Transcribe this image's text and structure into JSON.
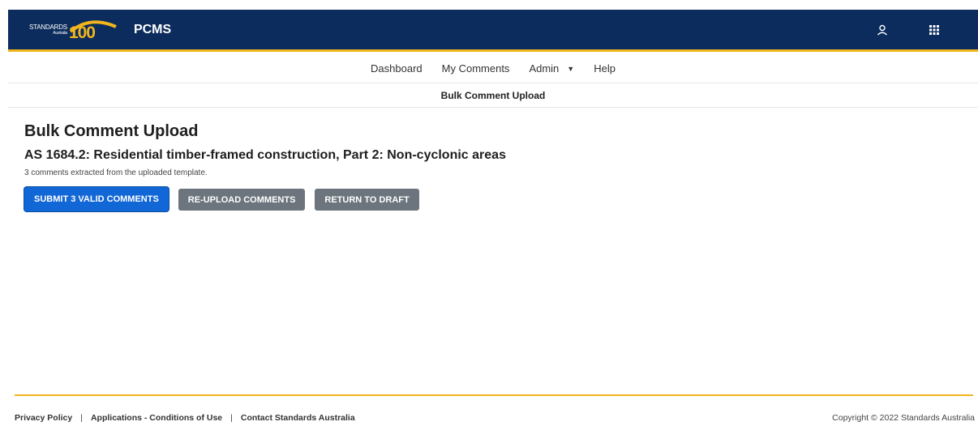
{
  "header": {
    "logo_text": "STANDARDS",
    "logo_sub": "Australia",
    "logo_number": "100",
    "app_title": "PCMS",
    "icons": [
      "user-icon",
      "apps-grid-icon"
    ]
  },
  "nav": {
    "items": [
      {
        "label": "Dashboard"
      },
      {
        "label": "My Comments"
      },
      {
        "label": "Admin"
      },
      {
        "label": "Help"
      }
    ],
    "sub_title": "Bulk Comment Upload"
  },
  "main": {
    "title": "Bulk Comment Upload",
    "standard": "AS 1684.2: Residential timber-framed construction, Part 2: Non-cyclonic areas",
    "info": "3 comments extracted from the uploaded template.",
    "buttons": {
      "submit": "SUBMIT 3 VALID COMMENTS",
      "reupload": "RE-UPLOAD COMMENTS",
      "return": "RETURN TO DRAFT"
    }
  },
  "footer": {
    "links": [
      "Privacy Policy",
      "Applications - Conditions of Use",
      "Contact Standards Australia"
    ],
    "separator": "|",
    "copyright": "Copyright © 2022 Standards Australia"
  },
  "colors": {
    "header_bg": "#0b2c5c",
    "accent": "#f2b51c",
    "primary": "#1167d6",
    "secondary": "#6c757d"
  }
}
